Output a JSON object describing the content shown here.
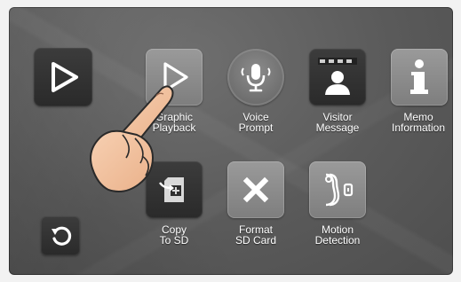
{
  "menu": {
    "items": [
      {
        "id": "graphic_playback",
        "line1": "Graphic",
        "line2": "Playback",
        "icon": "play-icon"
      },
      {
        "id": "voice_prompt",
        "line1": "Voice",
        "line2": "Prompt",
        "icon": "microphone-icon"
      },
      {
        "id": "visitor_message",
        "line1": "Visitor",
        "line2": "Message",
        "icon": "visitor-icon"
      },
      {
        "id": "memo_information",
        "line1": "Memo",
        "line2": "Information",
        "icon": "info-icon"
      },
      {
        "id": "copy_to_sd",
        "line1": "Copy",
        "line2": "To SD",
        "icon": "sd-copy-icon"
      },
      {
        "id": "format_sd_card",
        "line1": "Format",
        "line2": "SD Card",
        "icon": "close-icon"
      },
      {
        "id": "motion_detection",
        "line1": "Motion",
        "line2": "Detection",
        "icon": "motion-icon"
      }
    ]
  },
  "side": {
    "play_icon": "play-icon",
    "back_icon": "back-icon"
  },
  "colors": {
    "screen": "#5a5a5a",
    "tile_dark": "#2f2f2f",
    "tile_light": "#8c8c8c",
    "text": "#ffffff"
  }
}
